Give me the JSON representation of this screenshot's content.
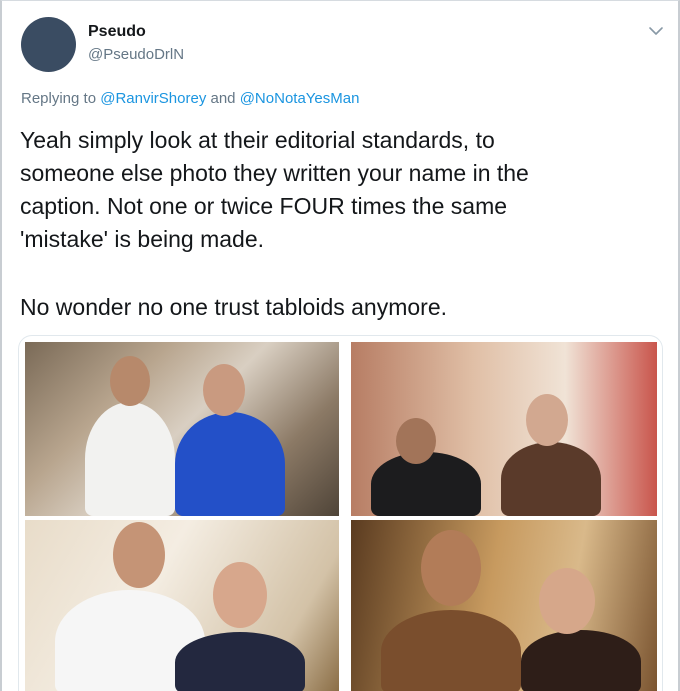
{
  "author": {
    "display_name": "Pseudo",
    "handle": "@PseudoDrlN",
    "avatar_color": "#3a4c62"
  },
  "reply": {
    "prefix": "Replying to",
    "user1": "@RanvirShorey",
    "joiner": "and",
    "user2": "@NoNotaYesMan"
  },
  "tweet": {
    "line1": "Yeah simply look at their editorial standards, to",
    "line2": "someone else photo they written your name in the",
    "line3": "caption. Not one or twice FOUR times the same",
    "line4": "'mistake' is being made.",
    "line5": "No wonder no one trust tabloids anymore."
  },
  "icons": {
    "more": "chevron-down-icon"
  },
  "colors": {
    "link": "#1b95e0",
    "secondary_text": "#657786",
    "primary_text": "#14171a"
  }
}
